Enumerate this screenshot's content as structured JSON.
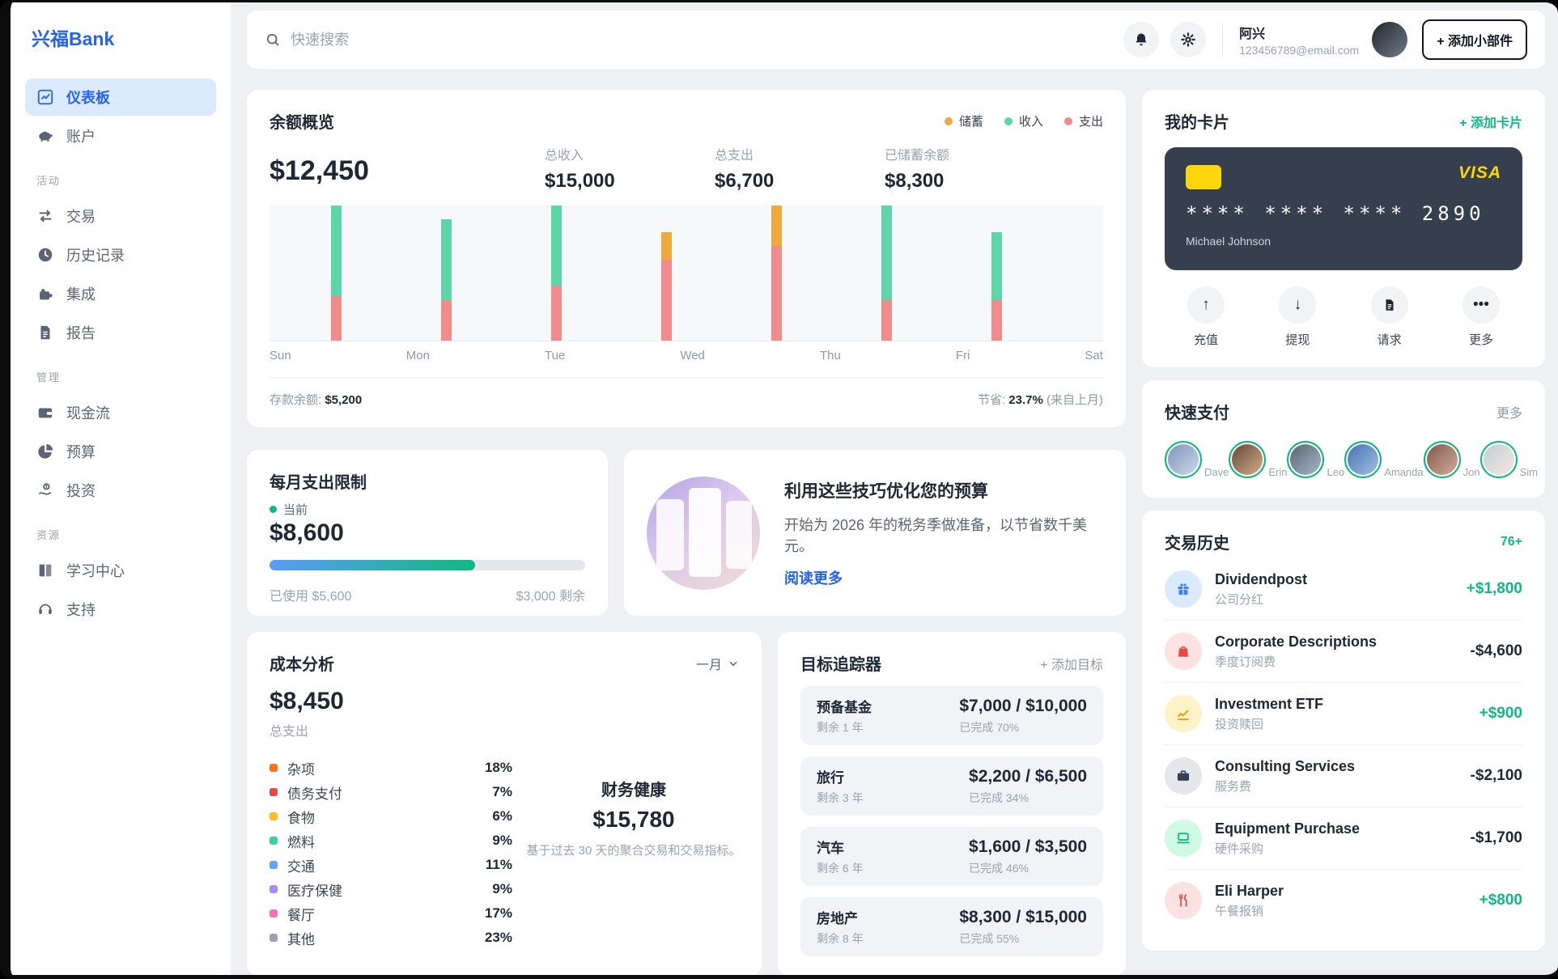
{
  "brand": {
    "logo": "兴福Bank"
  },
  "sidebar": {
    "groups": [
      {
        "label": "",
        "items": [
          {
            "label": "仪表板",
            "active": true
          },
          {
            "label": "账户",
            "active": false
          }
        ]
      },
      {
        "label": "活动",
        "items": [
          {
            "label": "交易"
          },
          {
            "label": "历史记录"
          },
          {
            "label": "集成"
          },
          {
            "label": "报告"
          }
        ]
      },
      {
        "label": "管理",
        "items": [
          {
            "label": "现金流"
          },
          {
            "label": "预算"
          },
          {
            "label": "投资"
          }
        ]
      },
      {
        "label": "资源",
        "items": [
          {
            "label": "学习中心"
          },
          {
            "label": "支持"
          }
        ]
      }
    ]
  },
  "topbar": {
    "search_placeholder": "快速搜索",
    "user_name": "阿兴",
    "user_email": "123456789@email.com",
    "add_widget_label": "+ 添加小部件"
  },
  "balance": {
    "title": "余额概览",
    "legend": [
      {
        "label": "储蓄",
        "color": "#f0a93c"
      },
      {
        "label": "收入",
        "color": "#5cd6a9"
      },
      {
        "label": "支出",
        "color": "#f28b8b"
      }
    ],
    "balance": "$12,450",
    "stats": [
      {
        "label": "总收入",
        "value": "$15,000"
      },
      {
        "label": "总支出",
        "value": "$6,700"
      },
      {
        "label": "已储蓄余额",
        "value": "$8,300"
      }
    ],
    "footer_left_label": "存款余额:",
    "footer_left_value": "$5,200",
    "footer_right_label": "节省:",
    "footer_right_value": "23.7%",
    "footer_right_suffix": "(来自上月)"
  },
  "chart_data": {
    "type": "bar",
    "stacked": true,
    "categories": [
      "Sun",
      "Mon",
      "Tue",
      "Wed",
      "Thu",
      "Fri",
      "Sat"
    ],
    "series": [
      {
        "name": "支出",
        "key": "expense",
        "color": "#f28b8b",
        "values": [
          33,
          30,
          41,
          60,
          70,
          30,
          30
        ]
      },
      {
        "name": "收入",
        "key": "income",
        "color": "#5cd6a9",
        "values": [
          67,
          60,
          59,
          0,
          0,
          70,
          50
        ]
      },
      {
        "name": "储蓄",
        "key": "savings",
        "color": "#f0a93c",
        "values": [
          0,
          0,
          0,
          20,
          30,
          0,
          0
        ]
      }
    ],
    "values_unit": "percent_of_plot_height_estimated",
    "legend_position": "top-right",
    "grid": false
  },
  "spend_limit": {
    "title": "每月支出限制",
    "current_label": "当前",
    "amount": "$8,600",
    "pct_used": "65%",
    "used_label": "已使用 $5,600",
    "remaining_label": "$3,000 剩余"
  },
  "tips": {
    "title": "利用这些技巧优化您的预算",
    "body": "开始为 2026 年的税务季做准备，以节省数千美元。",
    "read_more": "阅读更多"
  },
  "cost": {
    "title": "成本分析",
    "period": "一月",
    "total": "$8,450",
    "total_label": "总支出",
    "categories": [
      {
        "label": "杂项",
        "pct": "18%",
        "color": "#f97316"
      },
      {
        "label": "债务支付",
        "pct": "7%",
        "color": "#ef4444"
      },
      {
        "label": "食物",
        "pct": "6%",
        "color": "#fbbf24"
      },
      {
        "label": "燃料",
        "pct": "9%",
        "color": "#34d399"
      },
      {
        "label": "交通",
        "pct": "11%",
        "color": "#60a5fa"
      },
      {
        "label": "医疗保健",
        "pct": "9%",
        "color": "#a78bfa"
      },
      {
        "label": "餐厅",
        "pct": "17%",
        "color": "#f472b6"
      },
      {
        "label": "其他",
        "pct": "23%",
        "color": "#9ca3af"
      }
    ],
    "health_title": "财务健康",
    "health_value": "$15,780",
    "health_caption": "基于过去 30 天的聚合交易和交易指标。"
  },
  "goals": {
    "title": "目标追踪器",
    "add_label": "+ 添加目标",
    "items": [
      {
        "name": "预备基金",
        "remaining": "剩余 1 年",
        "amount": "$7,000 / $10,000",
        "done": "已完成 70%"
      },
      {
        "name": "旅行",
        "remaining": "剩余 3 年",
        "amount": "$2,200 / $6,500",
        "done": "已完成 34%"
      },
      {
        "name": "汽车",
        "remaining": "剩余 6 年",
        "amount": "$1,600 / $3,500",
        "done": "已完成 46%"
      },
      {
        "name": "房地产",
        "remaining": "剩余 8 年",
        "amount": "$8,300 / $15,000",
        "done": "已完成 55%"
      }
    ]
  },
  "cards": {
    "title": "我的卡片",
    "add_label": "+ 添加卡片",
    "network": "VISA",
    "number": "**** **** **** 2890",
    "holder": "Michael Johnson",
    "card_bg": "#363f4d",
    "accent": "#ffd60a",
    "actions": [
      {
        "label": "充值"
      },
      {
        "label": "提现"
      },
      {
        "label": "请求"
      },
      {
        "label": "更多"
      }
    ]
  },
  "quickpay": {
    "title": "快速支付",
    "more_label": "更多",
    "contacts": [
      "Dave",
      "Erin",
      "Leo",
      "Amanda",
      "Jon",
      "Sim"
    ]
  },
  "transactions": {
    "title": "交易历史",
    "badge": "76+",
    "items": [
      {
        "name": "Dividendpost",
        "desc": "公司分红",
        "amount": "+$1,800",
        "positive": true,
        "icon_color": "#3b82f6",
        "icon_bg": "#dbeafe"
      },
      {
        "name": "Corporate Descriptions",
        "desc": "季度订阅费",
        "amount": "-$4,600",
        "positive": false,
        "icon_color": "#ef4444",
        "icon_bg": "#fee2e2"
      },
      {
        "name": "Investment ETF",
        "desc": "投资赎回",
        "amount": "+$900",
        "positive": true,
        "icon_color": "#f59e0b",
        "icon_bg": "#fef3c7"
      },
      {
        "name": "Consulting Services",
        "desc": "服务费",
        "amount": "-$2,100",
        "positive": false,
        "icon_color": "#334155",
        "icon_bg": "#e5e7eb"
      },
      {
        "name": "Equipment Purchase",
        "desc": "硬件采购",
        "amount": "-$1,700",
        "positive": false,
        "icon_color": "#10b981",
        "icon_bg": "#d1fae5"
      },
      {
        "name": "Eli Harper",
        "desc": "午餐报销",
        "amount": "+$800",
        "positive": true,
        "icon_color": "#ef4444",
        "icon_bg": "#fee2e2"
      }
    ]
  }
}
